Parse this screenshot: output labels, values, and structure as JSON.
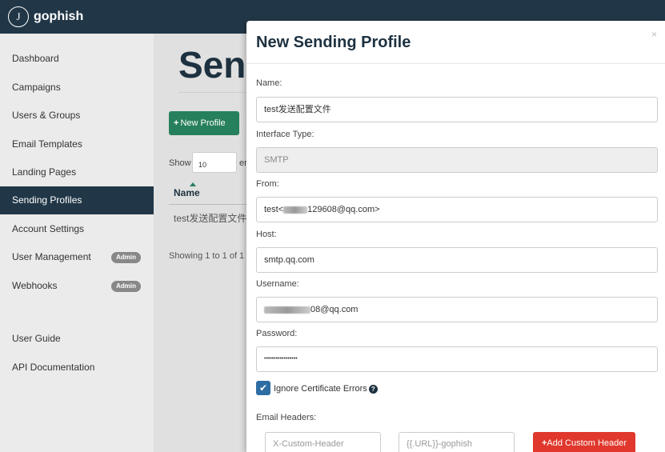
{
  "app": {
    "brand": "gophish",
    "logo_glyph": "J"
  },
  "sidebar": {
    "items": [
      {
        "label": "Dashboard"
      },
      {
        "label": "Campaigns"
      },
      {
        "label": "Users & Groups"
      },
      {
        "label": "Email Templates"
      },
      {
        "label": "Landing Pages"
      },
      {
        "label": "Sending Profiles",
        "active": true
      },
      {
        "label": "Account Settings"
      },
      {
        "label": "User Management",
        "badge": "Admin"
      },
      {
        "label": "Webhooks",
        "badge": "Admin"
      },
      {
        "label": "User Guide"
      },
      {
        "label": "API Documentation"
      }
    ]
  },
  "main": {
    "title": "Send",
    "new_button": "New Profile",
    "new_button_icon": "+",
    "show_label": "Show",
    "show_value": "10",
    "show_suffix": "er",
    "table": {
      "header": "Name",
      "rows": [
        "test发送配置文件"
      ]
    },
    "info": "Showing 1 to 1 of 1 e"
  },
  "modal": {
    "title": "New Sending Profile",
    "close": "×",
    "name_label": "Name:",
    "name_value": "test发送配置文件",
    "interface_label": "Interface Type:",
    "interface_value": "SMTP",
    "from_label": "From:",
    "from_prefix": "test<",
    "from_suffix": "129608@qq.com>",
    "host_label": "Host:",
    "host_value": "smtp.qq.com",
    "username_label": "Username:",
    "username_suffix": "08@qq.com",
    "password_label": "Password:",
    "password_value": "•••••••••••••••••",
    "ignore_cert_label": "Ignore Certificate Errors",
    "ignore_cert_checked": true,
    "email_headers_label": "Email Headers:",
    "header_name_placeholder": "X-Custom-Header",
    "header_value_placeholder": "{{.URL}}-gophish",
    "add_header_button": "Add Custom Header",
    "add_header_icon": "+"
  },
  "colors": {
    "nav_bg": "#213747",
    "success": "#27805c",
    "danger": "#e0382d",
    "checkbox": "#2e6da4"
  }
}
